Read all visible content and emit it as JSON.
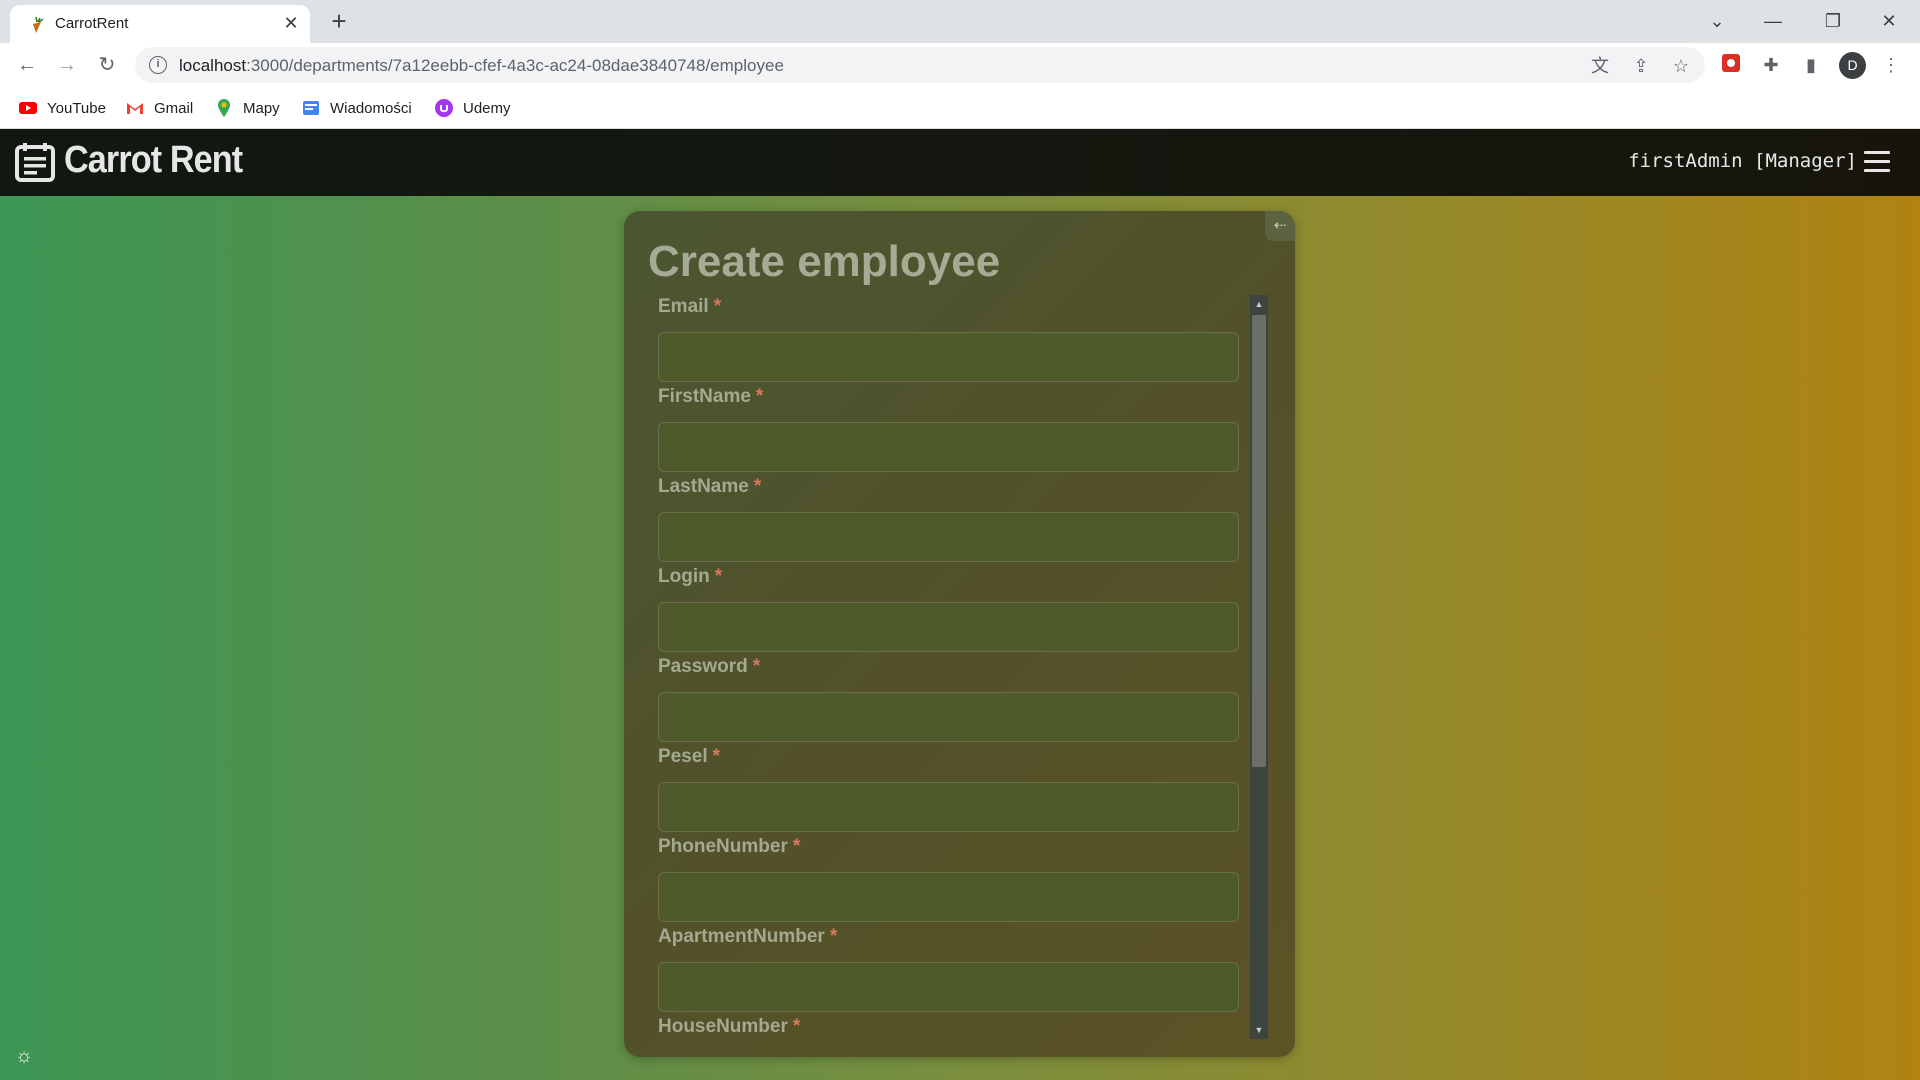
{
  "browser": {
    "tab_title": "CarrotRent",
    "tab_close": "✕",
    "new_tab": "+",
    "url_host": "localhost",
    "url_rest": ":3000/departments/7a12eebb-cfef-4a3c-ac24-08dae3840748/employee",
    "bookmarks": [
      {
        "label": "YouTube",
        "icon": "youtube-icon"
      },
      {
        "label": "Gmail",
        "icon": "gmail-icon"
      },
      {
        "label": "Mapy",
        "icon": "maps-icon"
      },
      {
        "label": "Wiadomości",
        "icon": "news-icon"
      },
      {
        "label": "Udemy",
        "icon": "udemy-icon"
      }
    ],
    "profile_initial": "D"
  },
  "app": {
    "brand": "Carrot Rent",
    "user_label": "firstAdmin [Manager]",
    "form": {
      "title": "Create employee",
      "required_mark": "*",
      "fields": [
        {
          "label": "Email",
          "value": ""
        },
        {
          "label": "FirstName",
          "value": ""
        },
        {
          "label": "LastName",
          "value": ""
        },
        {
          "label": "Login",
          "value": ""
        },
        {
          "label": "Password",
          "value": ""
        },
        {
          "label": "Pesel",
          "value": ""
        },
        {
          "label": "PhoneNumber",
          "value": ""
        },
        {
          "label": "ApartmentNumber",
          "value": ""
        },
        {
          "label": "HouseNumber",
          "value": ""
        }
      ]
    }
  },
  "colors": {
    "accent_required": "#d9785e",
    "gradient_left": "#3d9654",
    "gradient_right": "#b08312",
    "appbar_bg": "#141810"
  }
}
